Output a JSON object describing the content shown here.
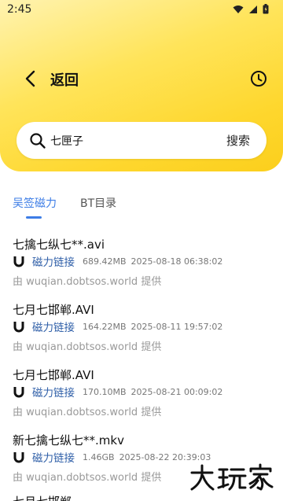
{
  "status_bar": {
    "time": "2:45"
  },
  "nav": {
    "back_label": "返回"
  },
  "search": {
    "query": "七匣子",
    "button_label": "搜索"
  },
  "tabs": [
    {
      "label": "吴签磁力",
      "active": true
    },
    {
      "label": "BT目录",
      "active": false
    }
  ],
  "results": [
    {
      "title": "七擒七纵七**.avi",
      "link_label": "磁力链接",
      "size": "689.42MB",
      "date": "2025-08-18 06:38:02",
      "source": "由 wuqian.dobtsos.world 提供"
    },
    {
      "title": "七月七邯郸.AVI",
      "link_label": "磁力链接",
      "size": "164.22MB",
      "date": "2025-08-11 19:57:02",
      "source": "由 wuqian.dobtsos.world 提供"
    },
    {
      "title": "七月七邯郸.AVI",
      "link_label": "磁力链接",
      "size": "170.10MB",
      "date": "2025-08-21 00:09:02",
      "source": "由 wuqian.dobtsos.world 提供"
    },
    {
      "title": "新七擒七纵七**.mkv",
      "link_label": "磁力链接",
      "size": "1.46GB",
      "date": "2025-08-22 20:39:03",
      "source": "由 wuqian.dobtsos.world 提供"
    }
  ],
  "partial_item": {
    "title": "七月七邯郸..."
  },
  "watermark": {
    "text": "大玩家"
  },
  "colors": {
    "accent": "#3d7de6",
    "link": "#2f5fa8",
    "header_yellow": "#fed72e"
  },
  "icons": {
    "back": "chevron-left-icon",
    "history": "clock-icon",
    "search": "search-icon",
    "magnet": "magnet-icon"
  }
}
